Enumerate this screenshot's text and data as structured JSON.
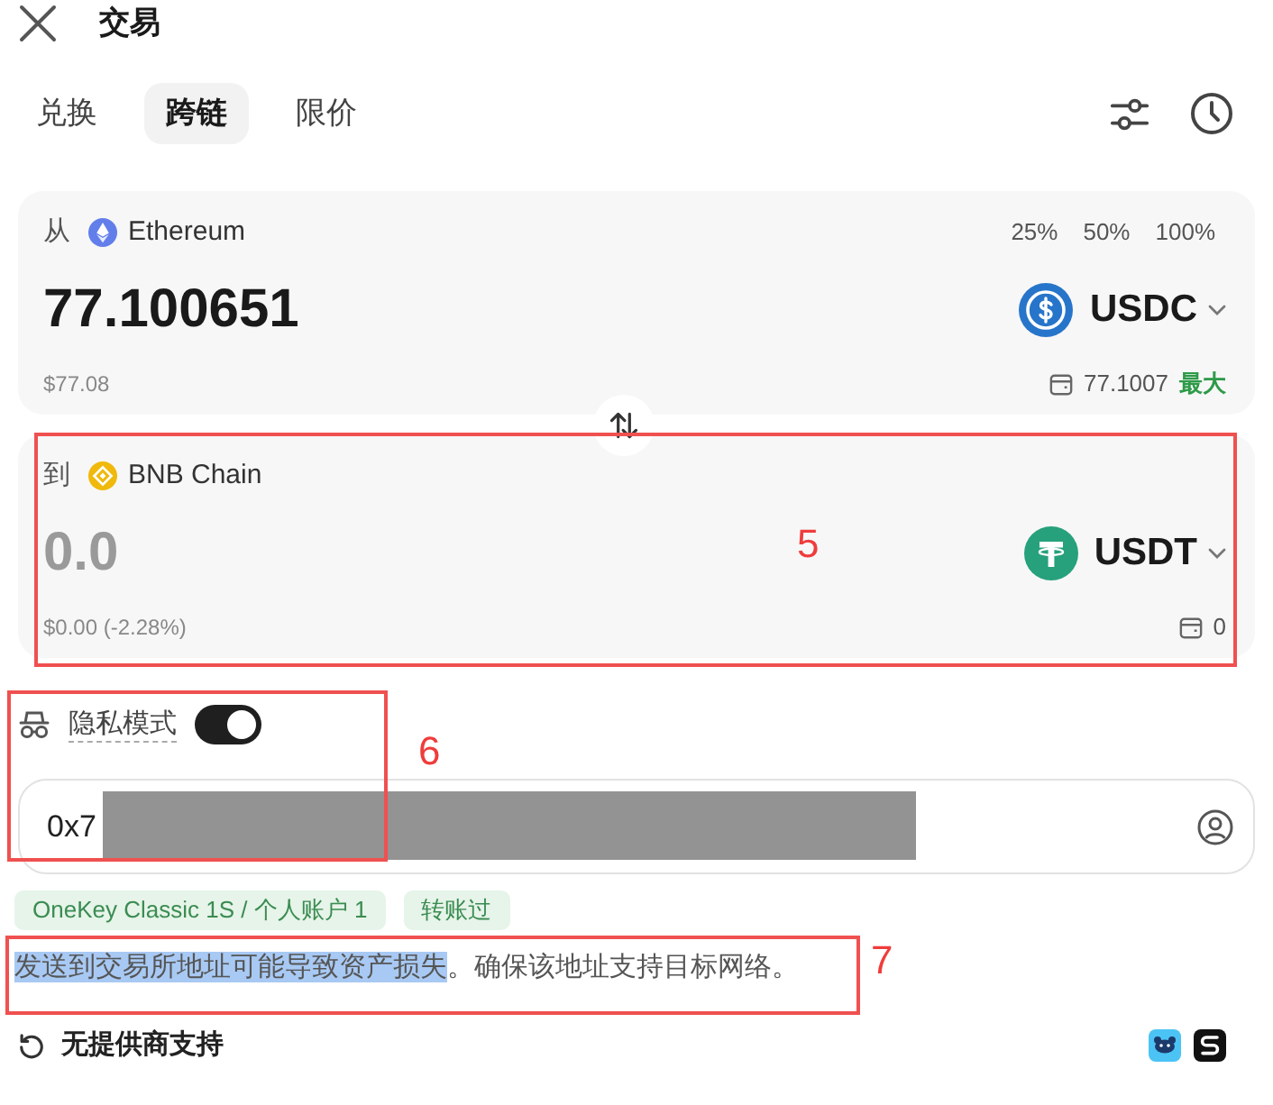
{
  "header": {
    "title": "交易"
  },
  "tabs": [
    {
      "label": "兑换",
      "selected": false
    },
    {
      "label": "跨链",
      "selected": true
    },
    {
      "label": "限价",
      "selected": false
    }
  ],
  "from": {
    "direction_label": "从",
    "network": "Ethereum",
    "percent_buttons": [
      "25%",
      "50%",
      "100%"
    ],
    "amount": "77.100651",
    "token": "USDC",
    "fiat_value": "$77.08",
    "balance": "77.1007",
    "max_label": "最大"
  },
  "to": {
    "direction_label": "到",
    "network": "BNB Chain",
    "amount": "0.0",
    "token": "USDT",
    "fiat_value": "$0.00 (-2.28%)",
    "balance": "0"
  },
  "privacy_mode": {
    "label": "隐私模式",
    "on": true
  },
  "address_field": {
    "value": "0x7"
  },
  "address_tags": [
    "OneKey Classic 1S / 个人账户 1",
    "转账过"
  ],
  "warning": [
    {
      "text": "发送到交易所地址可能导致资产损失",
      "selected": true
    },
    {
      "text": "。确保该地址支持目标网络。",
      "selected": false
    }
  ],
  "provider": {
    "status": "无提供商支持"
  },
  "annotations": [
    {
      "label": "5"
    },
    {
      "label": "6"
    },
    {
      "label": "7"
    }
  ]
}
